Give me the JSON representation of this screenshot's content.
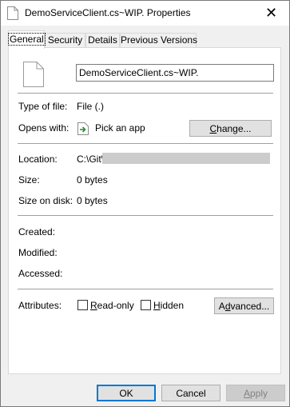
{
  "window": {
    "title": "DemoServiceClient.cs~WIP. Properties",
    "close_glyph": "✕"
  },
  "tabs": [
    {
      "label": "General",
      "active": true
    },
    {
      "label": "Security",
      "active": false
    },
    {
      "label": "Details",
      "active": false
    },
    {
      "label": "Previous Versions",
      "active": false
    }
  ],
  "general": {
    "file_name": "DemoServiceClient.cs~WIP.",
    "type_of_file_label": "Type of file:",
    "type_of_file_value": "File (.)",
    "opens_with_label": "Opens with:",
    "opens_with_value": "Pick an app",
    "change_button_pre": "",
    "change_button_u": "C",
    "change_button_post": "hange...",
    "location_label": "Location:",
    "location_value": "C:\\Git\\",
    "size_label": "Size:",
    "size_value": "0 bytes",
    "size_on_disk_label": "Size on disk:",
    "size_on_disk_value": "0 bytes",
    "created_label": "Created:",
    "modified_label": "Modified:",
    "accessed_label": "Accessed:",
    "attributes_label": "Attributes:",
    "readonly_u": "R",
    "readonly_rest": "ead-only",
    "hidden_u": "H",
    "hidden_rest": "idden",
    "advanced_pre": "A",
    "advanced_u": "d",
    "advanced_post": "vanced...",
    "readonly_checked": false,
    "hidden_checked": false
  },
  "footer": {
    "ok_label": "OK",
    "cancel_label": "Cancel",
    "apply_u": "A",
    "apply_rest": "pply",
    "apply_enabled": false
  },
  "colors": {
    "accent": "#0078d7",
    "window_bg": "#f0f0f0",
    "panel_bg": "#ffffff"
  },
  "icons": {
    "title": "document-icon",
    "file": "document-icon",
    "app": "pick-app-icon"
  }
}
